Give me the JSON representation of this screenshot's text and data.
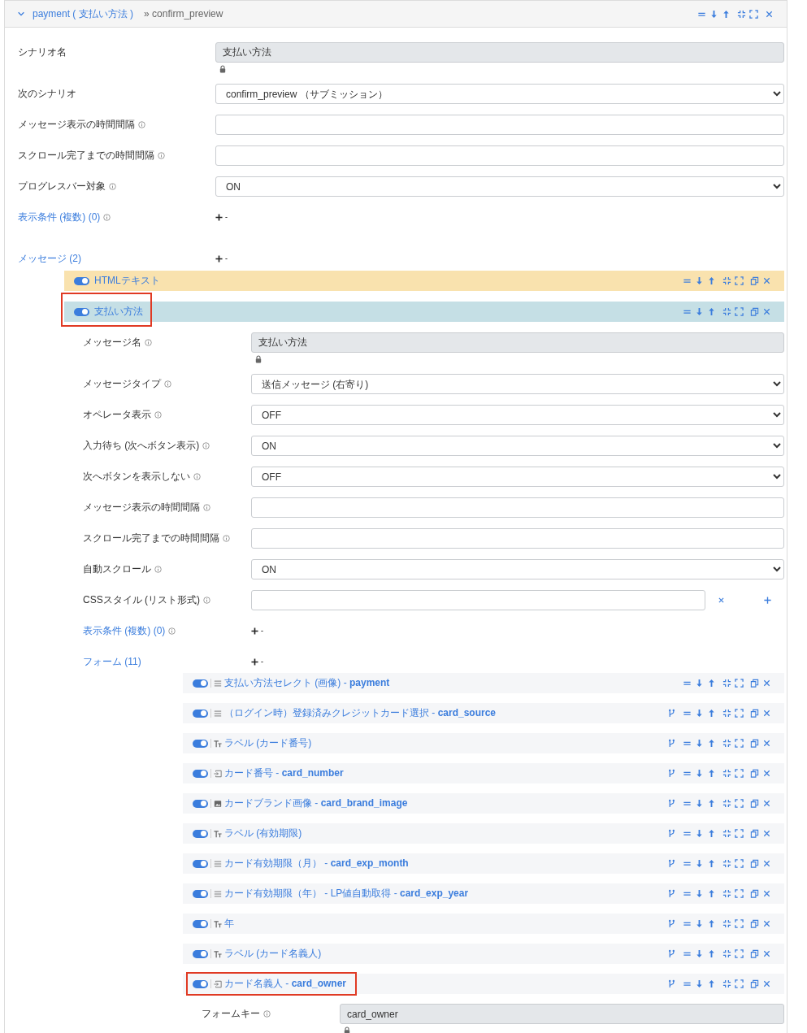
{
  "header": {
    "title": "payment ( 支払い方法 )",
    "subtitle": "» confirm_preview",
    "expanded": true
  },
  "fields": [
    {
      "kind": "readonly",
      "label": "シナリオ名",
      "value": "支払い方法"
    },
    {
      "kind": "select",
      "label": "次のシナリオ",
      "value": "confirm_preview （サブミッション）"
    },
    {
      "kind": "text",
      "label": "メッセージ表示の時間間隔",
      "info": true
    },
    {
      "kind": "text",
      "label": "スクロール完了までの時間間隔",
      "info": true
    },
    {
      "kind": "select",
      "label": "プログレスバー対象",
      "value": "ON",
      "info": true
    }
  ],
  "conditions": {
    "label": "表示条件 (複数) (0)",
    "info": true
  },
  "messages_label": "メッセージ (2)",
  "messages": [
    {
      "title": "HTMLテキスト",
      "color": "#f9e2ae",
      "enabled": true,
      "highlighted": false
    },
    {
      "title": "支払い方法",
      "color": "#c5dfe5",
      "enabled": true,
      "highlighted": true,
      "fields": [
        {
          "kind": "readonly",
          "label": "メッセージ名",
          "value": "支払い方法",
          "info": true
        },
        {
          "kind": "select",
          "label": "メッセージタイプ",
          "value": "送信メッセージ (右寄り)",
          "info": true
        },
        {
          "kind": "select",
          "label": "オペレータ表示",
          "value": "OFF",
          "info": true
        },
        {
          "kind": "select",
          "label": "入力待ち (次へボタン表示)",
          "value": "ON",
          "info": true
        },
        {
          "kind": "select",
          "label": "次へボタンを表示しない",
          "value": "OFF",
          "info": true
        },
        {
          "kind": "text",
          "label": "メッセージ表示の時間間隔",
          "info": true
        },
        {
          "kind": "text",
          "label": "スクロール完了までの時間間隔",
          "info": true
        },
        {
          "kind": "select",
          "label": "自動スクロール",
          "value": "ON",
          "info": true
        },
        {
          "kind": "list",
          "label": "CSSスタイル (リスト形式)",
          "info": true
        }
      ],
      "conditions": {
        "label": "表示条件 (複数) (0)",
        "info": true
      },
      "forms_label": "フォーム (11)",
      "forms": [
        {
          "kind": "list",
          "title": "支払い方法セレクト (画像) - **payment**",
          "enabled": true,
          "branch": false,
          "highlighted": false
        },
        {
          "kind": "list",
          "title": "（ログイン時）登録済みクレジットカード選択 - **card_source**",
          "enabled": true,
          "branch": true,
          "highlighted": false
        },
        {
          "kind": "text",
          "title": "ラベル (カード番号)",
          "enabled": true,
          "branch": true,
          "highlighted": false
        },
        {
          "kind": "input",
          "title": "カード番号 - **card_number**",
          "enabled": true,
          "branch": true,
          "highlighted": false
        },
        {
          "kind": "image",
          "title": "カードブランド画像 - **card_brand_image**",
          "enabled": true,
          "branch": true,
          "highlighted": false
        },
        {
          "kind": "text",
          "title": "ラベル (有効期限)",
          "enabled": true,
          "branch": true,
          "highlighted": false
        },
        {
          "kind": "list",
          "title": "カード有効期限（月） - **card_exp_month**",
          "enabled": true,
          "branch": true,
          "highlighted": false
        },
        {
          "kind": "list",
          "title": "カード有効期限（年） - LP値自動取得 - **card_exp_year**",
          "enabled": true,
          "branch": true,
          "highlighted": false
        },
        {
          "kind": "text",
          "title": "年",
          "enabled": true,
          "branch": true,
          "highlighted": false
        },
        {
          "kind": "text",
          "title": "ラベル (カード名義人)",
          "enabled": true,
          "branch": true,
          "highlighted": false
        },
        {
          "kind": "input",
          "title": "カード名義人 - **card_owner**",
          "enabled": true,
          "branch": true,
          "highlighted": true,
          "fields": [
            {
              "kind": "readonly",
              "label": "フォームキー",
              "value": "card_owner",
              "info": true
            }
          ]
        }
      ]
    }
  ]
}
